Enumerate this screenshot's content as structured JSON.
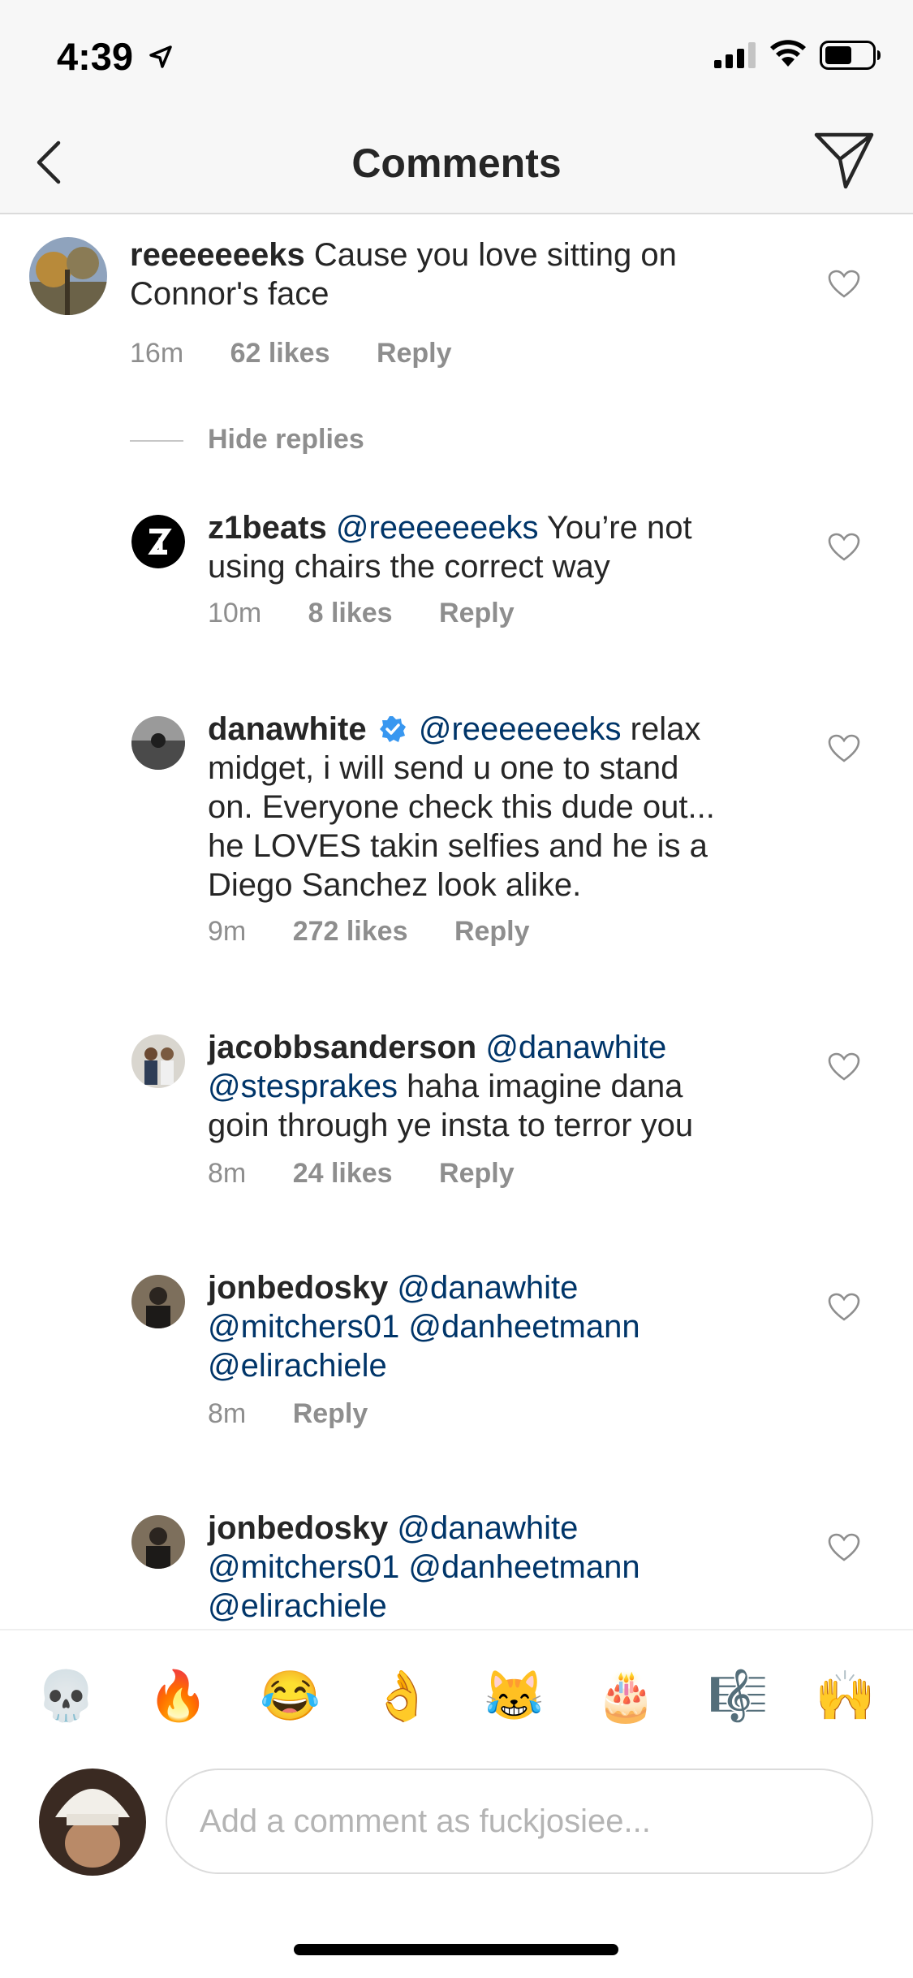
{
  "status": {
    "time": "4:39"
  },
  "nav": {
    "title": "Comments"
  },
  "comments": [
    {
      "username": "reeeeeeeks",
      "text_lines": [
        "Cause you love sitting on",
        "Connor's face"
      ],
      "time": "16m",
      "likes": "62 likes",
      "reply": "Reply"
    }
  ],
  "hide_replies": "Hide replies",
  "replies": [
    {
      "username": "z1beats",
      "mention": "@reeeeeeeks",
      "line1_text": "You’re not",
      "line2": "using chairs the correct way",
      "time": "10m",
      "likes": "8 likes",
      "reply": "Reply"
    },
    {
      "username": "danawhite",
      "mention": "@reeeeeeeks",
      "line1_text": "relax",
      "line2": "midget, i will send u one to stand",
      "line3": "on. Everyone check this dude out...",
      "line4": "he LOVES takin selfies and he is a",
      "line5": "Diego Sanchez look alike.",
      "time": "9m",
      "likes": "272 likes",
      "reply": "Reply"
    },
    {
      "username": "jacobbsanderson",
      "mention": "@danawhite",
      "mention2": "@stesprakes",
      "line2_text": "haha imagine dana",
      "line3": "goin through ye insta to terror you",
      "time": "8m",
      "likes": "24 likes",
      "reply": "Reply"
    },
    {
      "username": "jonbedosky",
      "mention": "@danawhite",
      "mention2": "@mitchers01",
      "mention3": "@danheetmann",
      "mention4": "@elirachiele",
      "time": "8m",
      "reply": "Reply"
    },
    {
      "username": "jonbedosky",
      "mention": "@danawhite",
      "mention2": "@mitchers01",
      "mention3": "@danheetmann",
      "mention4": "@elirachiele"
    }
  ],
  "emoji_bar": [
    "💀",
    "🔥",
    "😂",
    "👌",
    "😹",
    "🎂",
    "🎼",
    "🙌"
  ],
  "input": {
    "placeholder": "Add a comment as fuckjosiee..."
  },
  "colors": {
    "mention": "#003569",
    "meta": "#8e8e8e",
    "verified": "#3897f0"
  }
}
